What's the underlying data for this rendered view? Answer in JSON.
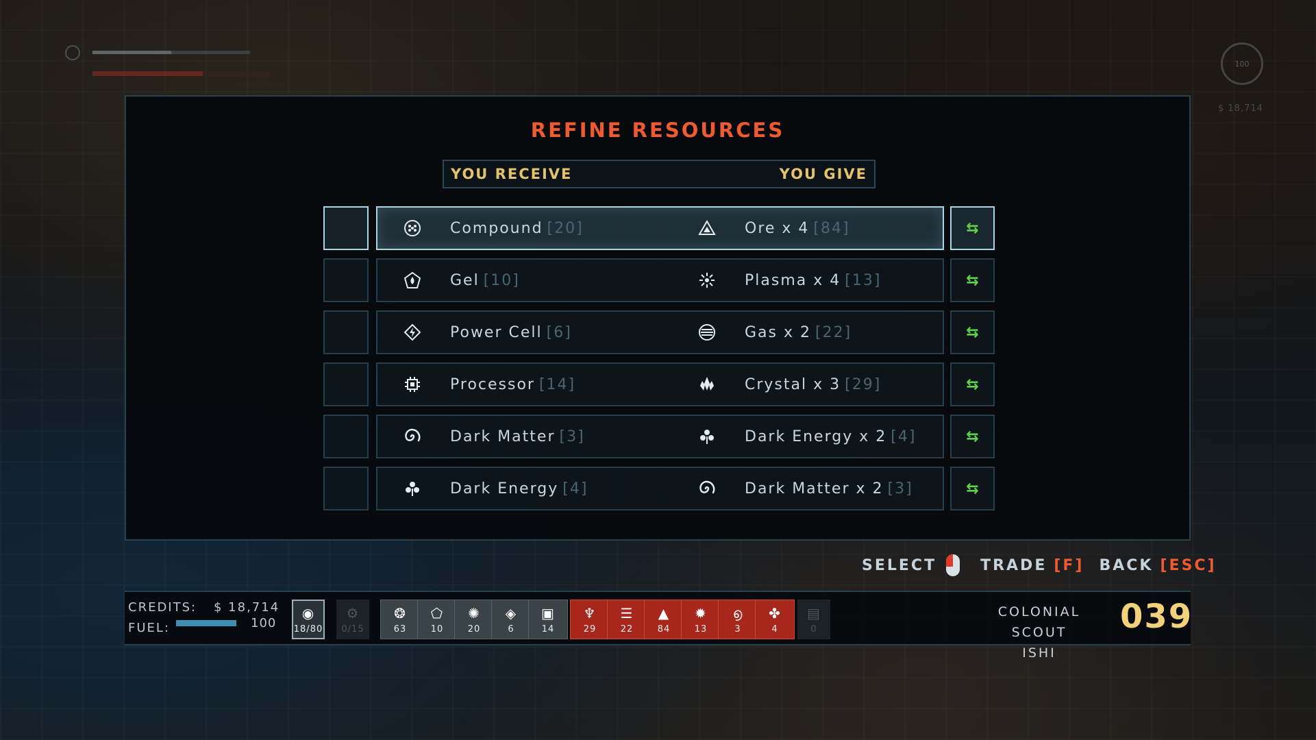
{
  "panel": {
    "title": "REFINE RESOURCES",
    "header_receive": "YOU RECEIVE",
    "header_give": "YOU GIVE"
  },
  "recipes": [
    {
      "receive": "Compound",
      "receive_qty": "[20]",
      "receive_icon": "compound-icon",
      "give": "Ore x 4",
      "give_qty": "[84]",
      "give_icon": "ore-icon",
      "selected": true
    },
    {
      "receive": "Gel",
      "receive_qty": "[10]",
      "receive_icon": "gel-icon",
      "give": "Plasma x 4",
      "give_qty": "[13]",
      "give_icon": "plasma-icon",
      "selected": false
    },
    {
      "receive": "Power Cell",
      "receive_qty": "[6]",
      "receive_icon": "power-cell-icon",
      "give": "Gas x 2",
      "give_qty": "[22]",
      "give_icon": "gas-icon",
      "selected": false
    },
    {
      "receive": "Processor",
      "receive_qty": "[14]",
      "receive_icon": "processor-icon",
      "give": "Crystal x 3",
      "give_qty": "[29]",
      "give_icon": "crystal-icon",
      "selected": false
    },
    {
      "receive": "Dark Matter",
      "receive_qty": "[3]",
      "receive_icon": "dark-matter-icon",
      "give": "Dark Energy x 2",
      "give_qty": "[4]",
      "give_icon": "dark-energy-icon",
      "selected": false
    },
    {
      "receive": "Dark Energy",
      "receive_qty": "[4]",
      "receive_icon": "dark-energy-icon",
      "give": "Dark Matter x 2",
      "give_qty": "[3]",
      "give_icon": "dark-matter-icon",
      "selected": false
    }
  ],
  "controls": {
    "select_label": "SELECT",
    "trade_label": "TRADE",
    "trade_key": "[F]",
    "back_label": "BACK",
    "back_key": "[ESC]"
  },
  "status": {
    "credits_label": "CREDITS:",
    "credits_value": "$ 18,714",
    "fuel_label": "FUEL:",
    "fuel_value": "100",
    "fuel_level": 1.0,
    "ship_class": "COLONIAL SCOUT",
    "pilot": "ISHI",
    "ship_number": "039"
  },
  "inventory": [
    {
      "icon": "cargo-icon",
      "count": "18/80",
      "style": "outline"
    },
    {
      "icon": "upgrade-icon",
      "count": "0/15",
      "style": "dim"
    },
    {
      "icon": "parts-icon",
      "count": "63",
      "style": "grey"
    },
    {
      "icon": "gel-icon",
      "count": "10",
      "style": "grey"
    },
    {
      "icon": "compound-icon",
      "count": "20",
      "style": "grey"
    },
    {
      "icon": "power-cell-icon",
      "count": "6",
      "style": "grey"
    },
    {
      "icon": "processor-icon",
      "count": "14",
      "style": "grey"
    },
    {
      "icon": "crystal-icon",
      "count": "29",
      "style": "red"
    },
    {
      "icon": "gas-icon",
      "count": "22",
      "style": "red"
    },
    {
      "icon": "ore-icon",
      "count": "84",
      "style": "red"
    },
    {
      "icon": "plasma-icon",
      "count": "13",
      "style": "red"
    },
    {
      "icon": "dark-matter-icon",
      "count": "3",
      "style": "red"
    },
    {
      "icon": "dark-energy-icon",
      "count": "4",
      "style": "red"
    },
    {
      "icon": "blueprint-icon",
      "count": "0",
      "style": "dim"
    }
  ],
  "hud": {
    "radar_value": "100",
    "credits_ghost": "$ 18,714"
  },
  "colors": {
    "title_accent": "#ee5a32",
    "header_text": "#e5c36a",
    "trade_arrow": "#62d24a",
    "resource_red": "#a8271c",
    "ship_number": "#f1d27a"
  }
}
